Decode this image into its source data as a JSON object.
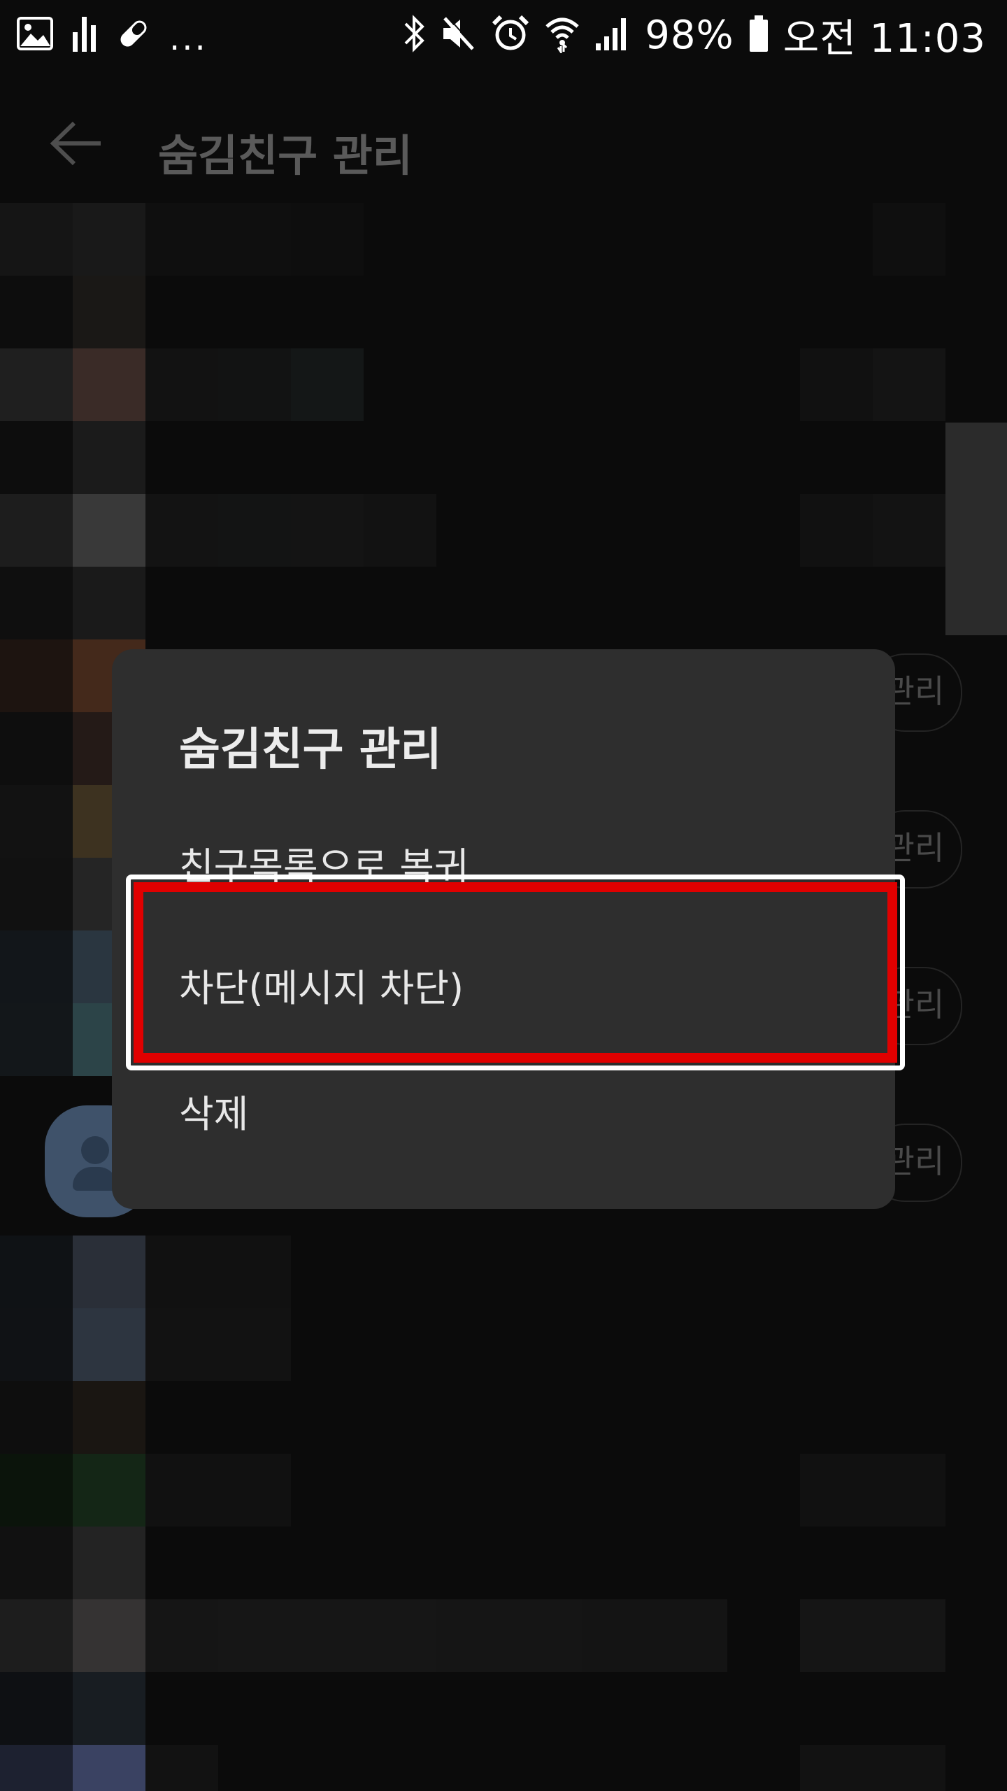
{
  "status_bar": {
    "icons_left": [
      "gallery-icon",
      "equalizer-icon",
      "pill-icon"
    ],
    "more_indicator": "...",
    "icons_right": [
      "bluetooth-icon",
      "mute-icon",
      "alarm-icon",
      "wifi-icon",
      "signal-icon"
    ],
    "battery_percent": "98%",
    "time": "오전 11:03"
  },
  "header": {
    "title": "숨김친구 관리",
    "back_icon": "back-arrow-icon"
  },
  "background": {
    "pill_label": "관리"
  },
  "dialog": {
    "title": "숨김친구 관리",
    "options": [
      "친구목록으로 복귀",
      "차단(메시지 차단)",
      "삭제"
    ]
  },
  "colors": {
    "highlight": "#e00000",
    "dialog_bg": "#2e2e2e",
    "screen_bg": "#0b0b0b"
  }
}
